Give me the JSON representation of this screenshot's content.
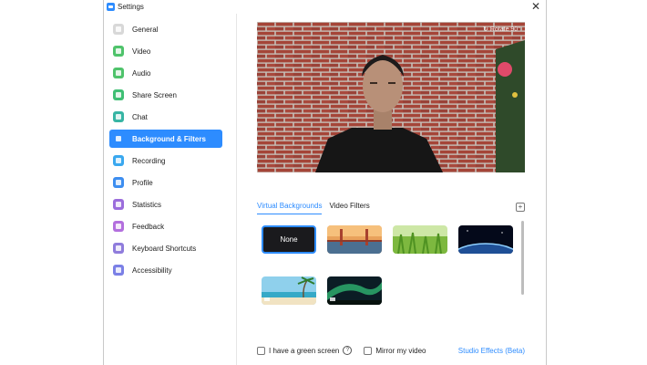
{
  "window": {
    "title": "Settings",
    "close_symbol": "✕"
  },
  "sidebar": {
    "items": [
      {
        "label": "General",
        "icon": "gear-icon",
        "color": "#d8d8d8"
      },
      {
        "label": "Video",
        "icon": "video-camera-icon",
        "color": "#4fc36b"
      },
      {
        "label": "Audio",
        "icon": "headphones-icon",
        "color": "#4fc36b"
      },
      {
        "label": "Share Screen",
        "icon": "share-screen-icon",
        "color": "#3fbf74"
      },
      {
        "label": "Chat",
        "icon": "chat-bubble-icon",
        "color": "#37b5a4"
      },
      {
        "label": "Background & Filters",
        "icon": "person-background-icon",
        "color": "#2d8cff"
      },
      {
        "label": "Recording",
        "icon": "record-icon",
        "color": "#3aa8ef"
      },
      {
        "label": "Profile",
        "icon": "profile-icon",
        "color": "#3d8ef0"
      },
      {
        "label": "Statistics",
        "icon": "statistics-icon",
        "color": "#9b6ddc"
      },
      {
        "label": "Feedback",
        "icon": "feedback-smiley-icon",
        "color": "#b36fde"
      },
      {
        "label": "Keyboard Shortcuts",
        "icon": "keyboard-icon",
        "color": "#8f7cdc"
      },
      {
        "label": "Accessibility",
        "icon": "accessibility-icon",
        "color": "#7b80e6"
      }
    ],
    "active_index": 5
  },
  "preview": {
    "rotate_label": "↻ Rotate 90°"
  },
  "tabs": [
    {
      "label": "Virtual Backgrounds",
      "active": true
    },
    {
      "label": "Video Filters",
      "active": false
    }
  ],
  "add_symbol": "+",
  "backgrounds": [
    {
      "name": "none",
      "label": "None",
      "selected": true
    },
    {
      "name": "golden-gate-bridge",
      "label": "",
      "selected": false
    },
    {
      "name": "grass",
      "label": "",
      "selected": false
    },
    {
      "name": "earth-from-space",
      "label": "",
      "selected": false
    },
    {
      "name": "beach",
      "label": "",
      "selected": false
    },
    {
      "name": "aurora",
      "label": "",
      "selected": false
    }
  ],
  "footer": {
    "green_screen": {
      "label": "I have a green screen",
      "checked": false
    },
    "help_symbol": "?",
    "mirror": {
      "label": "Mirror my video",
      "checked": false
    },
    "studio_effects": "Studio Effects (Beta)"
  }
}
